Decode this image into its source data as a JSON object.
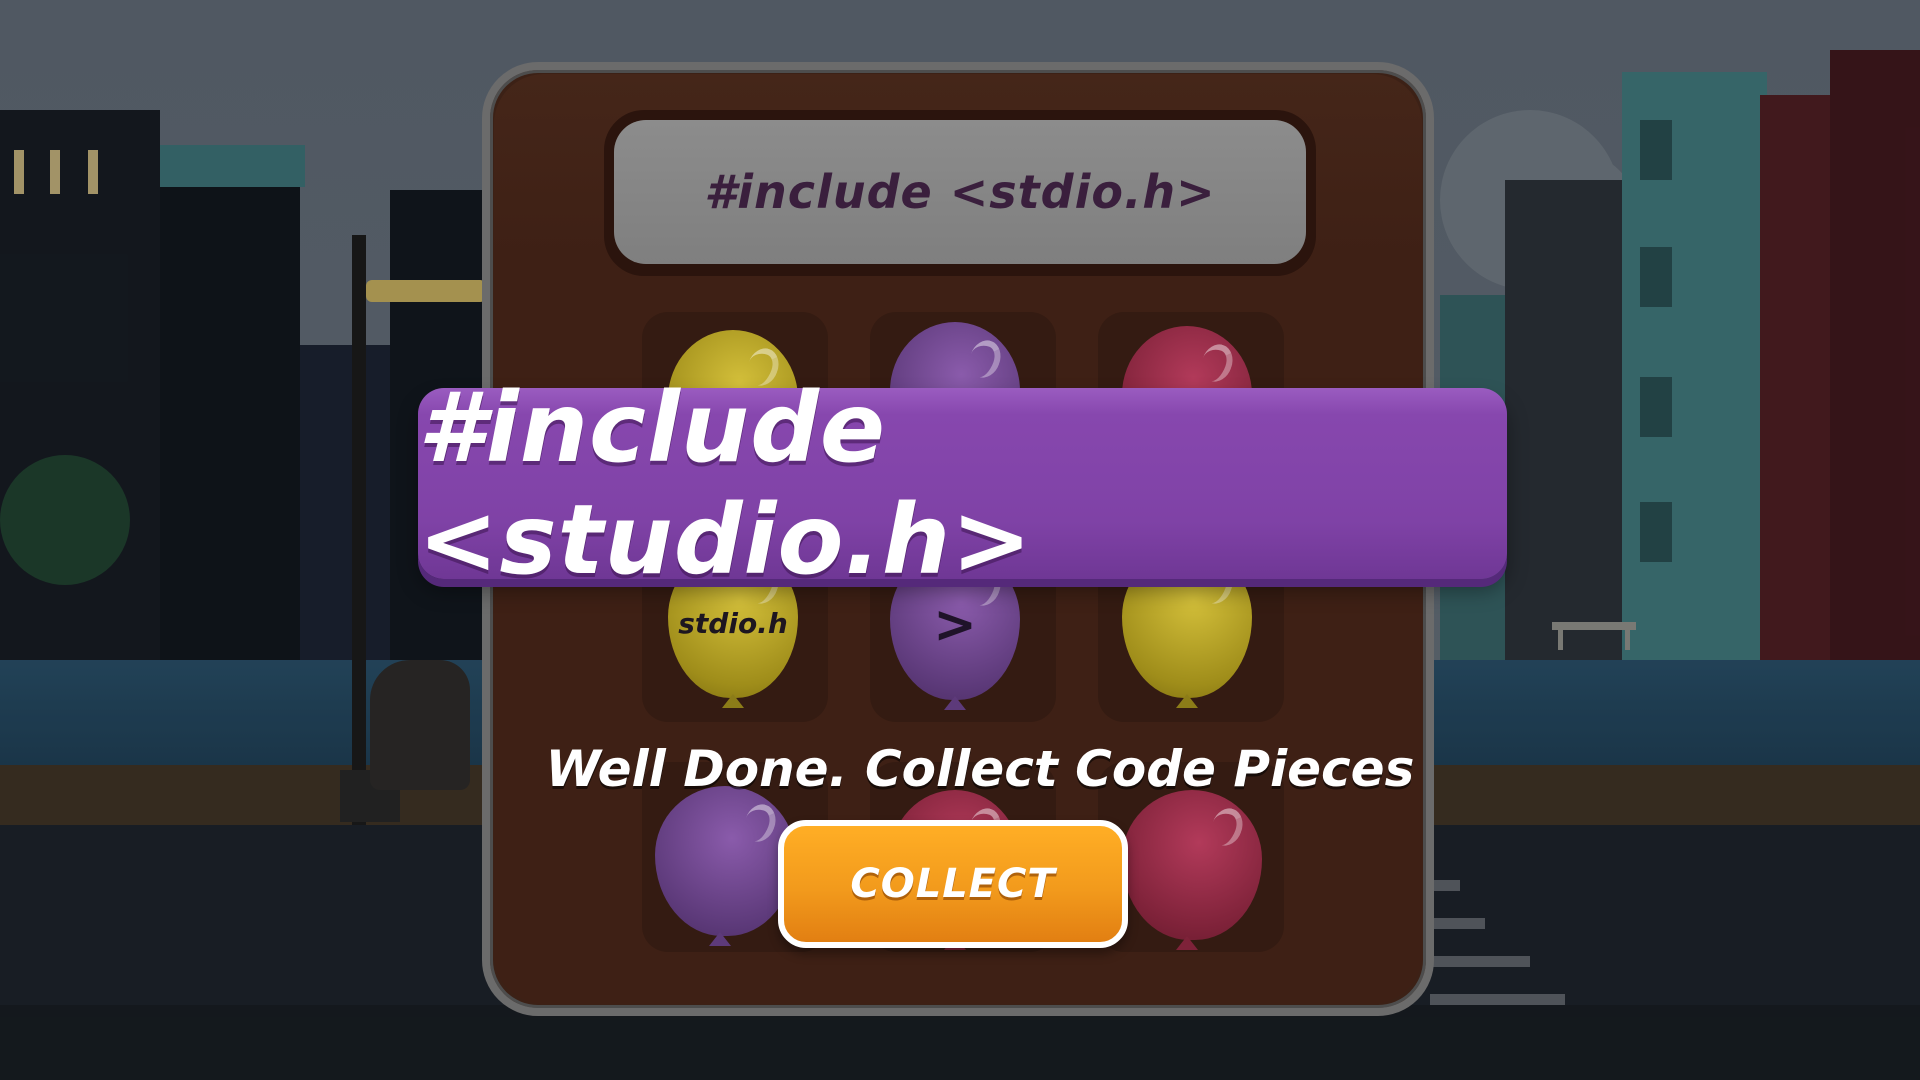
{
  "code_display": "#include <stdio.h>",
  "banner": "#include <studio.h>",
  "message": "Well Done. Collect Code Pieces",
  "collect_button": "COLLECT",
  "balloons": [
    {
      "color": "yellow",
      "label": ""
    },
    {
      "color": "purple",
      "label": ""
    },
    {
      "color": "red",
      "label": ""
    },
    {
      "color": "yellow",
      "label": "stdio.h"
    },
    {
      "color": "purple",
      "label": ">"
    },
    {
      "color": "yellow",
      "label": ""
    },
    {
      "color": "purple",
      "label": ""
    },
    {
      "color": "red",
      "label": ""
    },
    {
      "color": "red",
      "label": ""
    }
  ],
  "colors": {
    "banner": "#8747ae",
    "collect_button": "#f29a1c",
    "panel": "#3c2116"
  }
}
